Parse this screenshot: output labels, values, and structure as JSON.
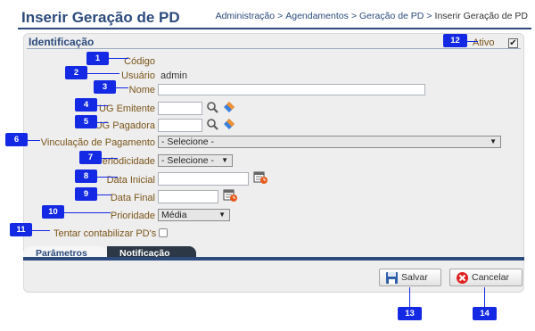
{
  "header": {
    "title": "Inserir Geração de PD",
    "breadcrumb": [
      "Administração",
      "Agendamentos",
      "Geração de PD",
      "Inserir Geração de PD"
    ],
    "separator": ">"
  },
  "panel": {
    "title": "Identificação"
  },
  "ativo": {
    "label": "Ativo",
    "checked": true
  },
  "fields": {
    "codigo": {
      "label": "Código"
    },
    "usuario": {
      "label": "Usuário",
      "value": "admin"
    },
    "nome": {
      "label": "Nome",
      "value": ""
    },
    "ug_emitente": {
      "label": "UG Emitente",
      "value": ""
    },
    "ug_pagadora": {
      "label": "UG Pagadora",
      "value": ""
    },
    "vinculacao": {
      "label": "Vinculação de Pagamento",
      "selected": "- Selecione -"
    },
    "periodicidade": {
      "label": "Periodicidade",
      "selected": "- Selecione -"
    },
    "data_inicial": {
      "label": "Data Inicial",
      "value": ""
    },
    "data_final": {
      "label": "Data Final",
      "value": ""
    },
    "prioridade": {
      "label": "Prioridade",
      "selected": "Média"
    },
    "contabilizar": {
      "label": "Tentar contabilizar PD's",
      "checked": false
    }
  },
  "tabs": [
    {
      "label": "Parâmetros",
      "active": true
    },
    {
      "label": "Notificação",
      "active": false
    }
  ],
  "buttons": {
    "save": "Salvar",
    "cancel": "Cancelar"
  },
  "callouts": [
    "1",
    "2",
    "3",
    "4",
    "5",
    "6",
    "7",
    "8",
    "9",
    "10",
    "11",
    "12",
    "13",
    "14"
  ],
  "colors": {
    "accent": "#2c4a7c",
    "callout": "#1329e3",
    "label": "#7a5418"
  },
  "icons": [
    "search-icon",
    "eraser-icon",
    "calendar-icon",
    "save-icon",
    "cancel-icon",
    "dropdown-arrow-icon"
  ]
}
